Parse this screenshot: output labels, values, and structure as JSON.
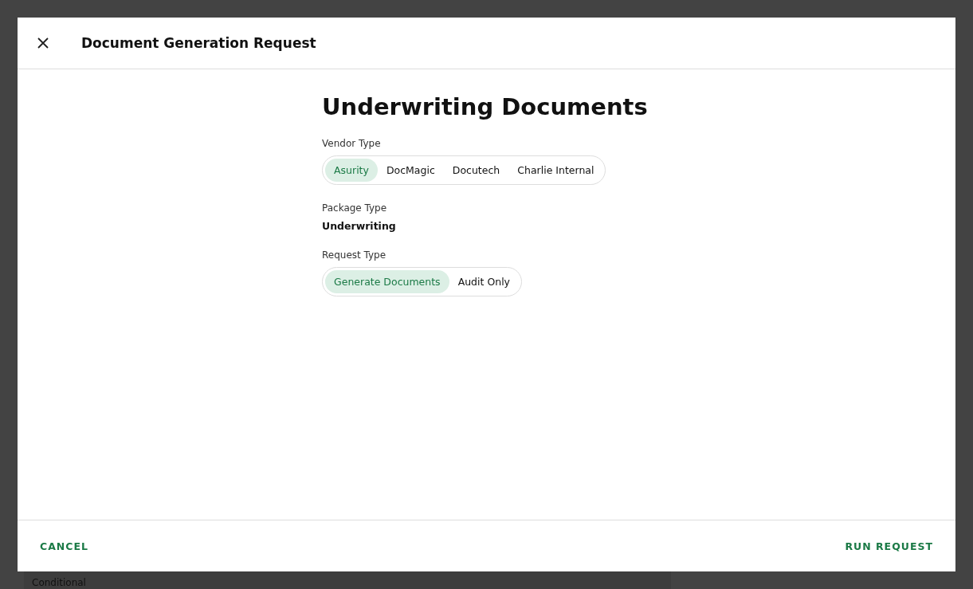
{
  "background": {
    "cell_text": "Conditional"
  },
  "dialog": {
    "title": "Document Generation Request",
    "heading": "Underwriting Documents",
    "fields": [
      {
        "kind": "choice",
        "label": "Vendor Type",
        "options": [
          {
            "label": "Asurity",
            "selected": true
          },
          {
            "label": "DocMagic",
            "selected": false
          },
          {
            "label": "Docutech",
            "selected": false
          },
          {
            "label": "Charlie Internal",
            "selected": false
          }
        ]
      },
      {
        "kind": "text",
        "label": "Package Type",
        "value": "Underwriting"
      },
      {
        "kind": "choice",
        "label": "Request Type",
        "options": [
          {
            "label": "Generate Documents",
            "selected": true
          },
          {
            "label": "Audit Only",
            "selected": false
          }
        ]
      }
    ],
    "buttons": [
      {
        "label": "CANCEL"
      },
      {
        "label": "RUN REQUEST"
      }
    ]
  }
}
